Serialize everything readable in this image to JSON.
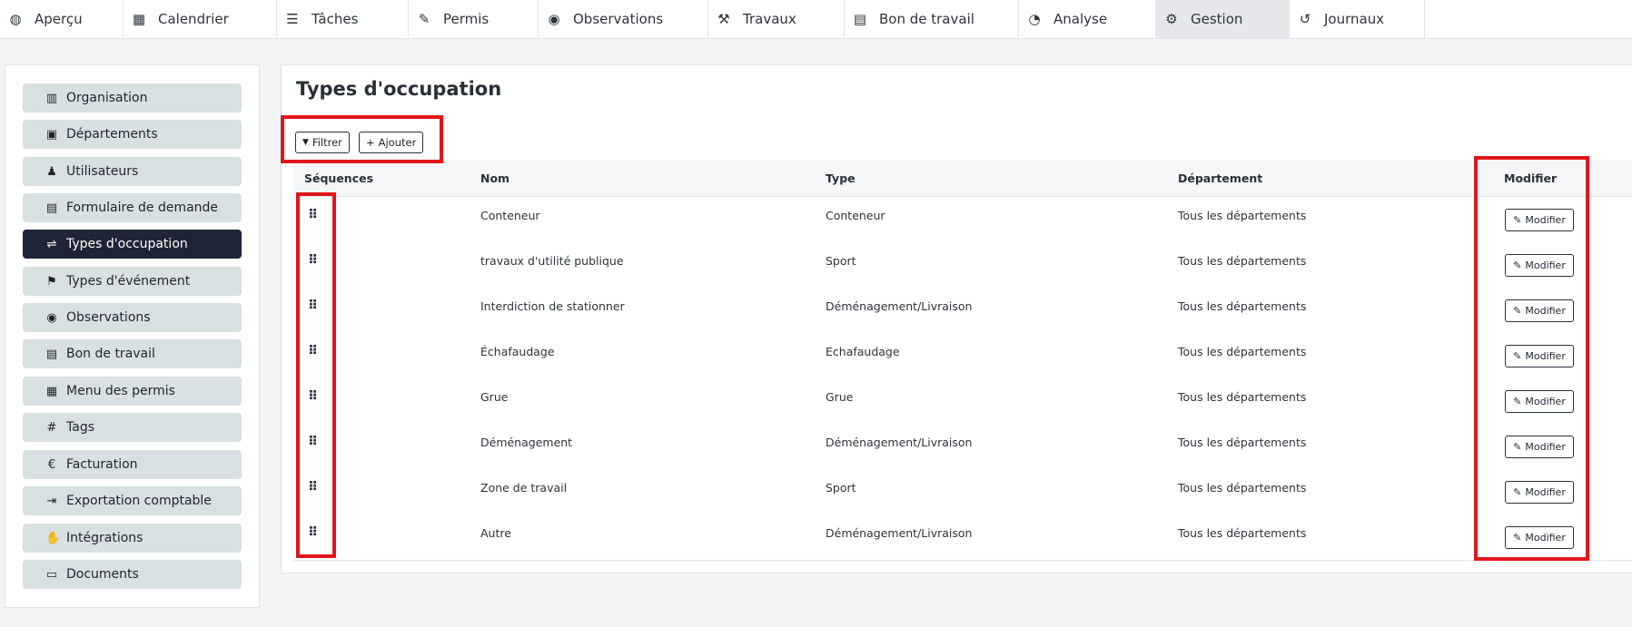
{
  "nav": {
    "tabs": [
      {
        "icon": "◍",
        "label": "Aperçu"
      },
      {
        "icon": "▦",
        "label": "Calendrier"
      },
      {
        "icon": "☰",
        "label": "Tâches"
      },
      {
        "icon": "✎",
        "label": "Permis"
      },
      {
        "icon": "◉",
        "label": "Observations"
      },
      {
        "icon": "⚒",
        "label": "Travaux"
      },
      {
        "icon": "▤",
        "label": "Bon de travail"
      },
      {
        "icon": "◔",
        "label": "Analyse"
      },
      {
        "icon": "⚙",
        "label": "Gestion"
      },
      {
        "icon": "↺",
        "label": "Journaux"
      }
    ]
  },
  "sidebar": {
    "items": [
      {
        "icon": "▥",
        "label": "Organisation"
      },
      {
        "icon": "▣",
        "label": "Départements"
      },
      {
        "icon": "♟",
        "label": "Utilisateurs"
      },
      {
        "icon": "▤",
        "label": "Formulaire de demande"
      },
      {
        "icon": "⇌",
        "label": "Types d'occupation"
      },
      {
        "icon": "⚑",
        "label": "Types d'événement"
      },
      {
        "icon": "◉",
        "label": "Observations"
      },
      {
        "icon": "▤",
        "label": "Bon de travail"
      },
      {
        "icon": "▦",
        "label": "Menu des permis"
      },
      {
        "icon": "#",
        "label": "Tags"
      },
      {
        "icon": "€",
        "label": "Facturation"
      },
      {
        "icon": "⇥",
        "label": "Exportation comptable"
      },
      {
        "icon": "✋",
        "label": "Intégrations"
      },
      {
        "icon": "▭",
        "label": "Documents"
      }
    ]
  },
  "main": {
    "title": "Types d'occupation",
    "filter_label": "Filtrer",
    "filter_icon": "▼",
    "add_label": "Ajouter",
    "add_icon": "+",
    "columns": [
      "Séquences",
      "Nom",
      "Type",
      "Département",
      "Modifier"
    ],
    "grip_icon": "⠿",
    "edit_icon": "✎",
    "edit_label": "Modifier",
    "rows": [
      {
        "nom": "Conteneur",
        "type": "Conteneur",
        "departement": "Tous les départements"
      },
      {
        "nom": "travaux d'utilité publique",
        "type": "Sport",
        "departement": "Tous les départements"
      },
      {
        "nom": "Interdiction de stationner",
        "type": "Déménagement/Livraison",
        "departement": "Tous les départements"
      },
      {
        "nom": "Échafaudage",
        "type": "Echafaudage",
        "departement": "Tous les départements"
      },
      {
        "nom": "Grue",
        "type": "Grue",
        "departement": "Tous les départements"
      },
      {
        "nom": "Déménagement",
        "type": "Déménagement/Livraison",
        "departement": "Tous les départements"
      },
      {
        "nom": "Zone de travail",
        "type": "Sport",
        "departement": "Tous les départements"
      },
      {
        "nom": "Autre",
        "type": "Déménagement/Livraison",
        "departement": "Tous les départements"
      }
    ]
  },
  "colors": {
    "highlight": "#e0161b",
    "active_sidebar": "#1f2536",
    "sidebar_item": "#d8e0e1"
  }
}
